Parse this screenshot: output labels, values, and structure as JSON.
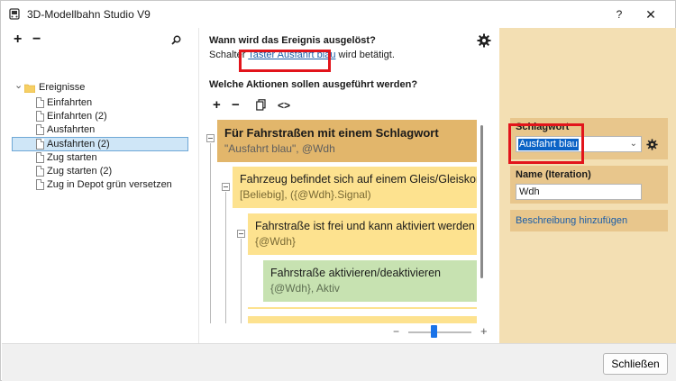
{
  "window": {
    "title": "3D-Modellbahn Studio V9",
    "help_label": "?",
    "close_label": "✕"
  },
  "tree": {
    "toolbar": {
      "add": "+",
      "remove": "−",
      "search_icon": "search-icon"
    },
    "root": {
      "expander": "⌄",
      "label": "Ereignisse"
    },
    "items": [
      {
        "label": "Einfahrten",
        "selected": false
      },
      {
        "label": "Einfahrten (2)",
        "selected": false
      },
      {
        "label": "Ausfahrten",
        "selected": false
      },
      {
        "label": "Ausfahrten (2)",
        "selected": true
      },
      {
        "label": "Zug starten",
        "selected": false
      },
      {
        "label": "Zug starten (2)",
        "selected": false
      },
      {
        "label": "Zug in Depot grün versetzen",
        "selected": false
      }
    ]
  },
  "middle": {
    "question_trigger": "Wann wird das Ereignis ausgelöst?",
    "trigger_prefix": "Schalter",
    "trigger_link": "Taster Ausfahrt blau",
    "trigger_suffix": "wird betätigt.",
    "question_actions": "Welche Aktionen sollen ausgeführt werden?",
    "action_toolbar": {
      "add": "+",
      "remove": "−",
      "copy_icon": "copy-icon",
      "code": "<>"
    },
    "actions": [
      {
        "title": "Für Fahrstraßen mit einem Schlagwort",
        "sub": "\"Ausfahrt blau\", @Wdh",
        "color": "#e2b66b"
      },
      {
        "title": "Fahrzeug befindet sich auf einem Gleis/Gleiskontakt",
        "sub": "[Beliebig], ({@Wdh}.Signal)",
        "color": "#fde28f"
      },
      {
        "title": "Fahrstraße ist frei und kann aktiviert werden",
        "sub": "{@Wdh}",
        "color": "#fde28f"
      },
      {
        "title": "Fahrstraße aktivieren/deaktivieren",
        "sub": "{@Wdh}, Aktiv",
        "color": "#c7e2b1"
      }
    ],
    "zoom": {
      "minus": "−",
      "plus": "+",
      "level": 0.4
    }
  },
  "properties": {
    "keyword_label": "Schlagwort",
    "keyword_value": "Ausfahrt blau",
    "name_label": "Name (Iteration)",
    "name_value": "Wdh",
    "add_description": "Beschreibung hinzufügen"
  },
  "footer": {
    "close_button": "Schließen"
  },
  "colors": {
    "accent": "#1a73e8",
    "highlight": "#e2141b",
    "panel": "#f3dfb3"
  }
}
